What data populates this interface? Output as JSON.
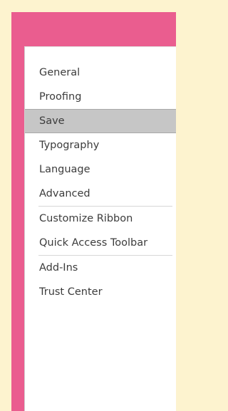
{
  "sidebar": {
    "groups": [
      {
        "items": [
          "General",
          "Proofing",
          "Save",
          "Typography",
          "Language",
          "Advanced"
        ]
      },
      {
        "items": [
          "Customize Ribbon",
          "Quick Access Toolbar"
        ]
      },
      {
        "items": [
          "Add-Ins",
          "Trust Center"
        ]
      }
    ],
    "selected": "Save"
  },
  "colors": {
    "page_background": "#fdf3cf",
    "title_bar": "#ea5d8f",
    "panel": "#ffffff",
    "selected_item": "#c6c6c6"
  }
}
